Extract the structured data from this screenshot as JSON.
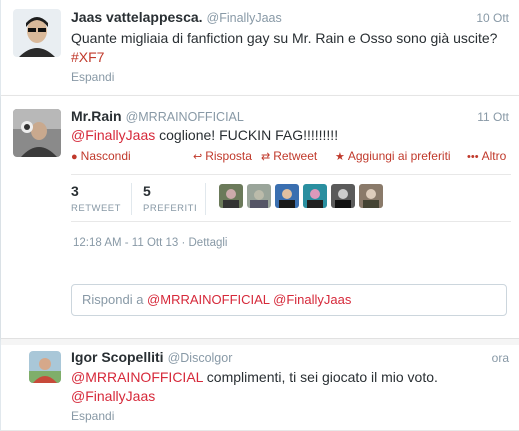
{
  "tweets": [
    {
      "name": "Jaas vattelappesca.",
      "handle": "@FinallyJaas",
      "date": "10 Ott",
      "text_line1": "Quante migliaia di fanfiction gay su Mr. Rain e Osso sono già uscite?",
      "hashtag": "#XF7",
      "expand": "Espandi"
    },
    {
      "name": "Mr.Rain",
      "handle": "@MRRAINOFFICIAL",
      "date": "11 Ott",
      "mention": "@FinallyJaas",
      "text": " coglione! FUCKIN FAG!!!!!!!!!",
      "actions": {
        "hide": "Nascondi",
        "reply": "Risposta",
        "retweet": "Retweet",
        "favorite": "Aggiungi ai preferiti",
        "more": "Altro"
      },
      "stats": {
        "retweets": "3",
        "retweets_label": "RETWEET",
        "favorites": "5",
        "favorites_label": "PREFERITI"
      },
      "meta_time": "12:18 AM - 11 Ott 13",
      "meta_sep": " · ",
      "meta_details": "Dettagli",
      "reply_prefix": "Rispondi a ",
      "reply_mentions": "@MRRAINOFFICIAL @FinallyJaas"
    },
    {
      "name": "Igor Scopelliti",
      "handle": "@Discolgor",
      "date": "ora",
      "mention1": "@MRRAINOFFICIAL",
      "text": " complimenti, ti sei giocato il mio voto.",
      "mention2": "@FinallyJaas",
      "expand": "Espandi"
    }
  ],
  "colors": {
    "accent": "#c0392b",
    "name": "#292f33",
    "muted": "#8899a6"
  }
}
